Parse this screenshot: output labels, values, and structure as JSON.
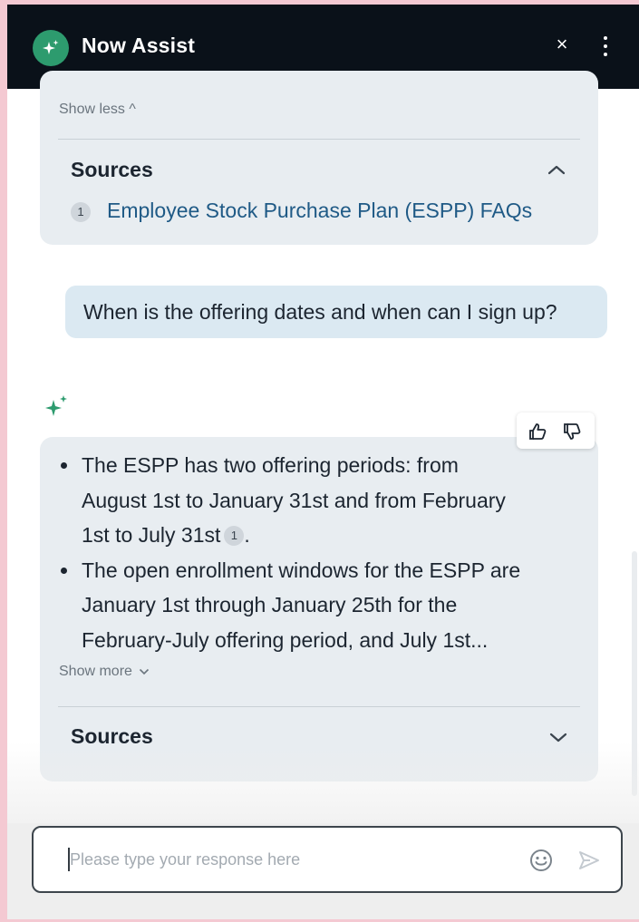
{
  "header": {
    "title": "Now Assist",
    "close_symbol": "×",
    "logo_icon": "sparkle-icon",
    "colors": {
      "background": "#0a1119",
      "logo": "#2d9b6e"
    }
  },
  "previous_response": {
    "show_less_label": "Show less ^",
    "sources_title": "Sources",
    "sources": [
      {
        "number": "1",
        "title": "Employee Stock Purchase Plan (ESPP) FAQs"
      }
    ]
  },
  "user_message": {
    "text": "When is the offering dates and when can I sign up?"
  },
  "assistant_response": {
    "bullets": [
      {
        "lines": [
          "The ESPP has two offering periods: from",
          "August 1st to January 31st and from February",
          "1st to July 31st"
        ],
        "citation": "1",
        "after_citation": "."
      },
      {
        "lines": [
          "The open enrollment windows for the ESPP are",
          "January 1st through January 25th for the",
          "February-July offering period, and July 1st..."
        ]
      }
    ],
    "show_more_label": "Show more",
    "sources_title": "Sources",
    "feedback_icons": [
      "thumbs-up-icon",
      "thumbs-down-icon"
    ]
  },
  "input": {
    "placeholder": "Please type your response here",
    "value": ""
  },
  "colors": {
    "accent": "#2d9b6e",
    "card": "#e8edf1",
    "user_bubble": "#dbe9f2",
    "link": "#1f5a86",
    "frame": "#f4c9d2"
  }
}
